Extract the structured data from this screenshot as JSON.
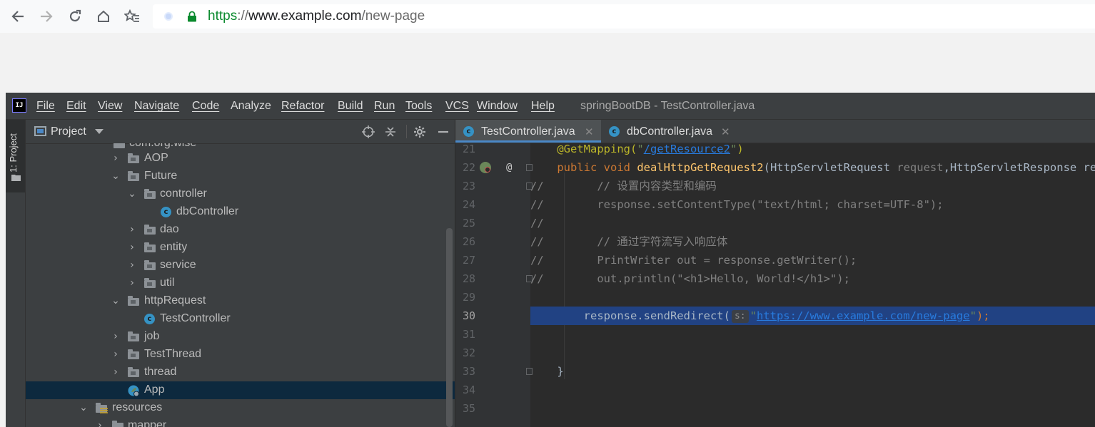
{
  "browser": {
    "url_scheme": "https",
    "url_separator": "://",
    "url_host": "www.example.com",
    "url_path": "/new-page",
    "icons": [
      "back-icon",
      "forward-icon",
      "reload-icon",
      "home-icon",
      "bookmarks-icon",
      "lock-icon"
    ]
  },
  "ide": {
    "logo_text": "IJ",
    "menu": [
      "File",
      "Edit",
      "View",
      "Navigate",
      "Code",
      "Analyze",
      "Refactor",
      "Build",
      "Run",
      "Tools",
      "VCS",
      "Window",
      "Help"
    ],
    "window_title": "springBootDB - TestController.java",
    "tool_stripe_label": "1: Project",
    "project_panel": {
      "title": "Project",
      "tree": [
        {
          "label": "com.org.wise",
          "type": "package"
        },
        {
          "label": "AOP",
          "type": "package",
          "expanded": false
        },
        {
          "label": "Future",
          "type": "package",
          "expanded": true
        },
        {
          "label": "controller",
          "type": "package",
          "expanded": true
        },
        {
          "label": "dbController",
          "type": "class"
        },
        {
          "label": "dao",
          "type": "package",
          "expanded": false
        },
        {
          "label": "entity",
          "type": "package",
          "expanded": false
        },
        {
          "label": "service",
          "type": "package",
          "expanded": false
        },
        {
          "label": "util",
          "type": "package",
          "expanded": false
        },
        {
          "label": "httpRequest",
          "type": "package",
          "expanded": true
        },
        {
          "label": "TestController",
          "type": "class"
        },
        {
          "label": "job",
          "type": "package",
          "expanded": false
        },
        {
          "label": "TestThread",
          "type": "package",
          "expanded": false
        },
        {
          "label": "thread",
          "type": "package",
          "expanded": false
        },
        {
          "label": "App",
          "type": "spring-app",
          "selected": true
        },
        {
          "label": "resources",
          "type": "resources-folder",
          "expanded": true
        },
        {
          "label": "mapper",
          "type": "folder",
          "expanded": false
        }
      ]
    },
    "editor": {
      "tabs": [
        {
          "label": "TestController.java",
          "active": true
        },
        {
          "label": "dbController.java",
          "active": false
        }
      ],
      "class_icon_letter": "c",
      "line_numbers": [
        "21",
        "22",
        "23",
        "24",
        "25",
        "26",
        "27",
        "28",
        "29",
        "30",
        "31",
        "32",
        "33",
        "34",
        "35"
      ],
      "current_line": "30",
      "code": {
        "l21_ann": "@GetMapping(",
        "l21_q1": "\"",
        "l21_path": "/getResource2",
        "l21_q2": "\"",
        "l21_end": ")",
        "l22_kw": "public void ",
        "l22_fn": "dealHttpGetRequest2",
        "l22_p1": "(HttpServletRequest ",
        "l22_param": "request",
        "l22_p2": ",HttpServletResponse response)",
        "l23": "//        // 设置内容类型和编码",
        "l24": "//        response.setContentType(\"text/html; charset=UTF-8\");",
        "l25": "//",
        "l26": "//        // 通过字符流写入响应体",
        "l27": "//        PrintWriter out = response.getWriter();",
        "l28": "//        out.println(\"<h1>Hello, World!</h1>\");",
        "l30_pre": "        response.sendRedirect(",
        "l30_hint": "s:",
        "l30_q1": "\"",
        "l30_url": "https://www.example.com/new-page",
        "l30_q2": "\"",
        "l30_end": ");",
        "l33": "    }"
      }
    }
  },
  "colors": {
    "https_green": "#0b8a2e",
    "ide_background": "#2b2b2b",
    "selection_blue": "#214283",
    "annotation": "#bbb529",
    "keyword": "#cc7832",
    "method": "#ffc66d",
    "string": "#6a8759",
    "link": "#287bde"
  }
}
